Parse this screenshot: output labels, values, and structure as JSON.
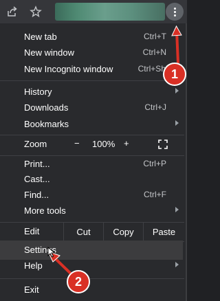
{
  "toolbar": {
    "icons": [
      "share-icon",
      "star-icon",
      "kebab-menu-icon"
    ]
  },
  "menu": {
    "new_tab": {
      "label": "New tab",
      "shortcut": "Ctrl+T"
    },
    "new_window": {
      "label": "New window",
      "shortcut": "Ctrl+N"
    },
    "new_incognito": {
      "label": "New Incognito window",
      "shortcut": "Ctrl+Shift+N"
    },
    "history": {
      "label": "History"
    },
    "downloads": {
      "label": "Downloads",
      "shortcut": "Ctrl+J"
    },
    "bookmarks": {
      "label": "Bookmarks"
    },
    "zoom": {
      "label": "Zoom",
      "minus": "−",
      "level": "100%",
      "plus": "+"
    },
    "print": {
      "label": "Print...",
      "shortcut": "Ctrl+P"
    },
    "cast": {
      "label": "Cast..."
    },
    "find": {
      "label": "Find...",
      "shortcut": "Ctrl+F"
    },
    "more_tools": {
      "label": "More tools"
    },
    "edit": {
      "label": "Edit",
      "cut": "Cut",
      "copy": "Copy",
      "paste": "Paste"
    },
    "settings": {
      "label": "Settings"
    },
    "help": {
      "label": "Help"
    },
    "exit": {
      "label": "Exit"
    }
  },
  "annotations": {
    "step1": "1",
    "step2": "2",
    "color": "#d93025"
  }
}
